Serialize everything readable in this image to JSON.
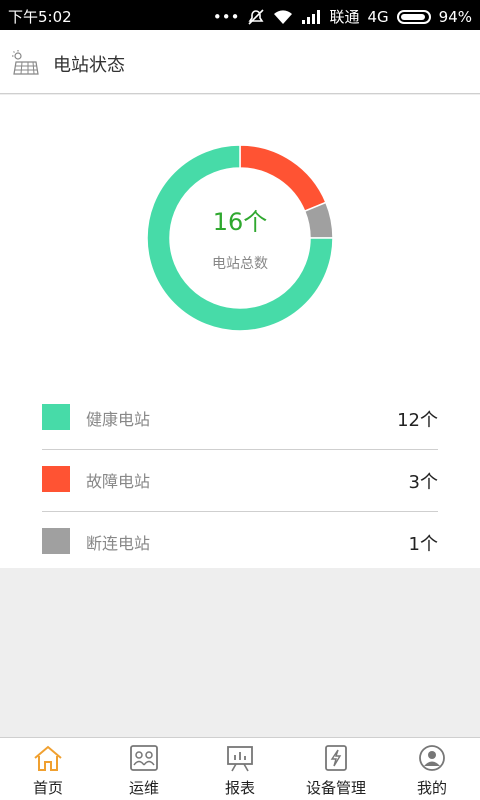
{
  "status_bar": {
    "time": "下午5:02",
    "carrier": "联通",
    "network": "4G",
    "battery": "94%",
    "battery_level": 0.94,
    "icons": [
      "dots-icon",
      "mute-icon",
      "wifi-icon",
      "signal-icon",
      "battery-icon"
    ]
  },
  "header": {
    "title": "电站状态",
    "icon": "solar-panel-icon"
  },
  "summary": {
    "total_value": "16个",
    "total_label": "电站总数"
  },
  "chart_data": {
    "type": "pie",
    "donut": true,
    "categories": [
      "健康电站",
      "故障电站",
      "断连电站"
    ],
    "values": [
      12,
      3,
      1
    ],
    "colors": [
      "#47dba8",
      "#ff5333",
      "#a0a0a0"
    ]
  },
  "legend": [
    {
      "label": "健康电站",
      "count": "12个",
      "color": "#47dba8"
    },
    {
      "label": "故障电站",
      "count": "3个",
      "color": "#ff5333"
    },
    {
      "label": "断连电站",
      "count": "1个",
      "color": "#a0a0a0"
    }
  ],
  "tabs": [
    {
      "label": "首页",
      "icon": "home-icon",
      "active": true
    },
    {
      "label": "运维",
      "icon": "contacts-icon",
      "active": false
    },
    {
      "label": "报表",
      "icon": "chart-board-icon",
      "active": false
    },
    {
      "label": "设备管理",
      "icon": "device-lightning-icon",
      "active": false
    },
    {
      "label": "我的",
      "icon": "user-icon",
      "active": false
    }
  ],
  "colors": {
    "accent": "#f0a030",
    "total_text": "#2fa82f"
  }
}
